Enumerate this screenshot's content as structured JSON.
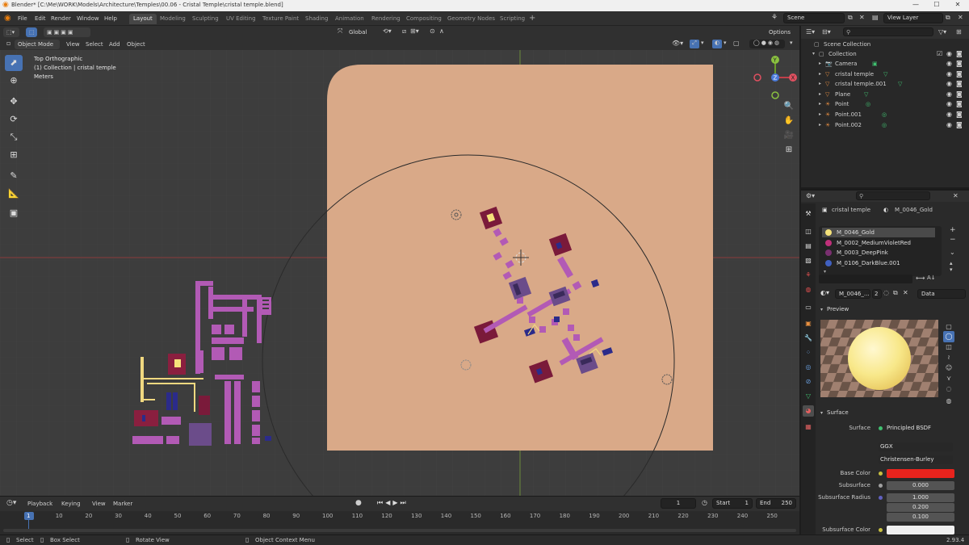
{
  "window": {
    "title": "Blender* [C:\\Me\\WORK\\Models\\Architecture\\Temples\\00.06 - Cristal Temple\\cristal temple.blend]",
    "controls": [
      "—",
      "☐",
      "✕"
    ]
  },
  "menu": [
    "File",
    "Edit",
    "Render",
    "Window",
    "Help"
  ],
  "workspaces": [
    "Layout",
    "Modeling",
    "Sculpting",
    "UV Editing",
    "Texture Paint",
    "Shading",
    "Animation",
    "Rendering",
    "Compositing",
    "Geometry Nodes",
    "Scripting"
  ],
  "active_workspace": "Layout",
  "scene": {
    "label": "Scene",
    "view_layer": "View Layer"
  },
  "viewport_header": {
    "mode": "Object Mode",
    "menus": [
      "View",
      "Select",
      "Add",
      "Object"
    ],
    "orientation": "Global",
    "options": "Options"
  },
  "viewport_overlay": {
    "view_name": "Top Orthographic",
    "collection_info": "(1) Collection | cristal temple",
    "units": "Meters"
  },
  "timeline": {
    "menus": [
      "Playback",
      "Keying",
      "View",
      "Marker"
    ],
    "current_frame": "1",
    "start_label": "Start",
    "start": "1",
    "end_label": "End",
    "end": "250",
    "ticks": [
      "1",
      "10",
      "20",
      "30",
      "40",
      "50",
      "60",
      "70",
      "80",
      "90",
      "100",
      "110",
      "120",
      "130",
      "140",
      "150",
      "160",
      "170",
      "180",
      "190",
      "200",
      "210",
      "220",
      "230",
      "240",
      "250"
    ]
  },
  "status_bar": {
    "select": "Select",
    "box_select": "Box Select",
    "rotate_view": "Rotate View",
    "context_menu": "Object Context Menu",
    "version": "2.93.4"
  },
  "outliner": {
    "root": "Scene Collection",
    "collection": "Collection",
    "items": [
      {
        "name": "Camera",
        "icon_color": "#e08a40"
      },
      {
        "name": "cristal temple",
        "icon_color": "#e08a40"
      },
      {
        "name": "cristal temple.001",
        "icon_color": "#e08a40"
      },
      {
        "name": "Plane",
        "icon_color": "#e08a40"
      },
      {
        "name": "Point",
        "icon_color": "#e08a40"
      },
      {
        "name": "Point.001",
        "icon_color": "#e08a40"
      },
      {
        "name": "Point.002",
        "icon_color": "#e08a40"
      }
    ]
  },
  "properties": {
    "object_name": "cristal temple",
    "material_name": "M_0046_Gold",
    "material_slots": [
      {
        "name": "M_0046_Gold",
        "color": "#f5e27a"
      },
      {
        "name": "M_0002_MediumVioletRed",
        "color": "#c0307a"
      },
      {
        "name": "M_0003_DeepPink",
        "color": "#7a3070"
      },
      {
        "name": "M_0106_DarkBlue.001",
        "color": "#4060c0"
      }
    ],
    "data_block": "M_0046_...",
    "users": "2",
    "link": "Data",
    "preview_label": "Preview",
    "surface_label": "Surface",
    "surface": "Principled BSDF",
    "distribution": "GGX",
    "subsurface_method": "Christensen-Burley",
    "base_color_label": "Base Color",
    "base_color": "#e8231d",
    "subsurface_label": "Subsurface",
    "subsurface": "0.000",
    "subsurface_radius_label": "Subsurface Radius",
    "subsurface_radius": [
      "1.000",
      "0.200",
      "0.100"
    ],
    "subsurface_color_label": "Subsurface Color",
    "subsurface_color": "#f0f0f0"
  },
  "colors": {
    "plane": "#d9a988",
    "accent": "#4772b3",
    "magenta": "#b25ab5",
    "dark_red": "#7a1a3a",
    "gold": "#f0d880",
    "navy": "#2b2b8a",
    "purple": "#6b4c8a"
  }
}
